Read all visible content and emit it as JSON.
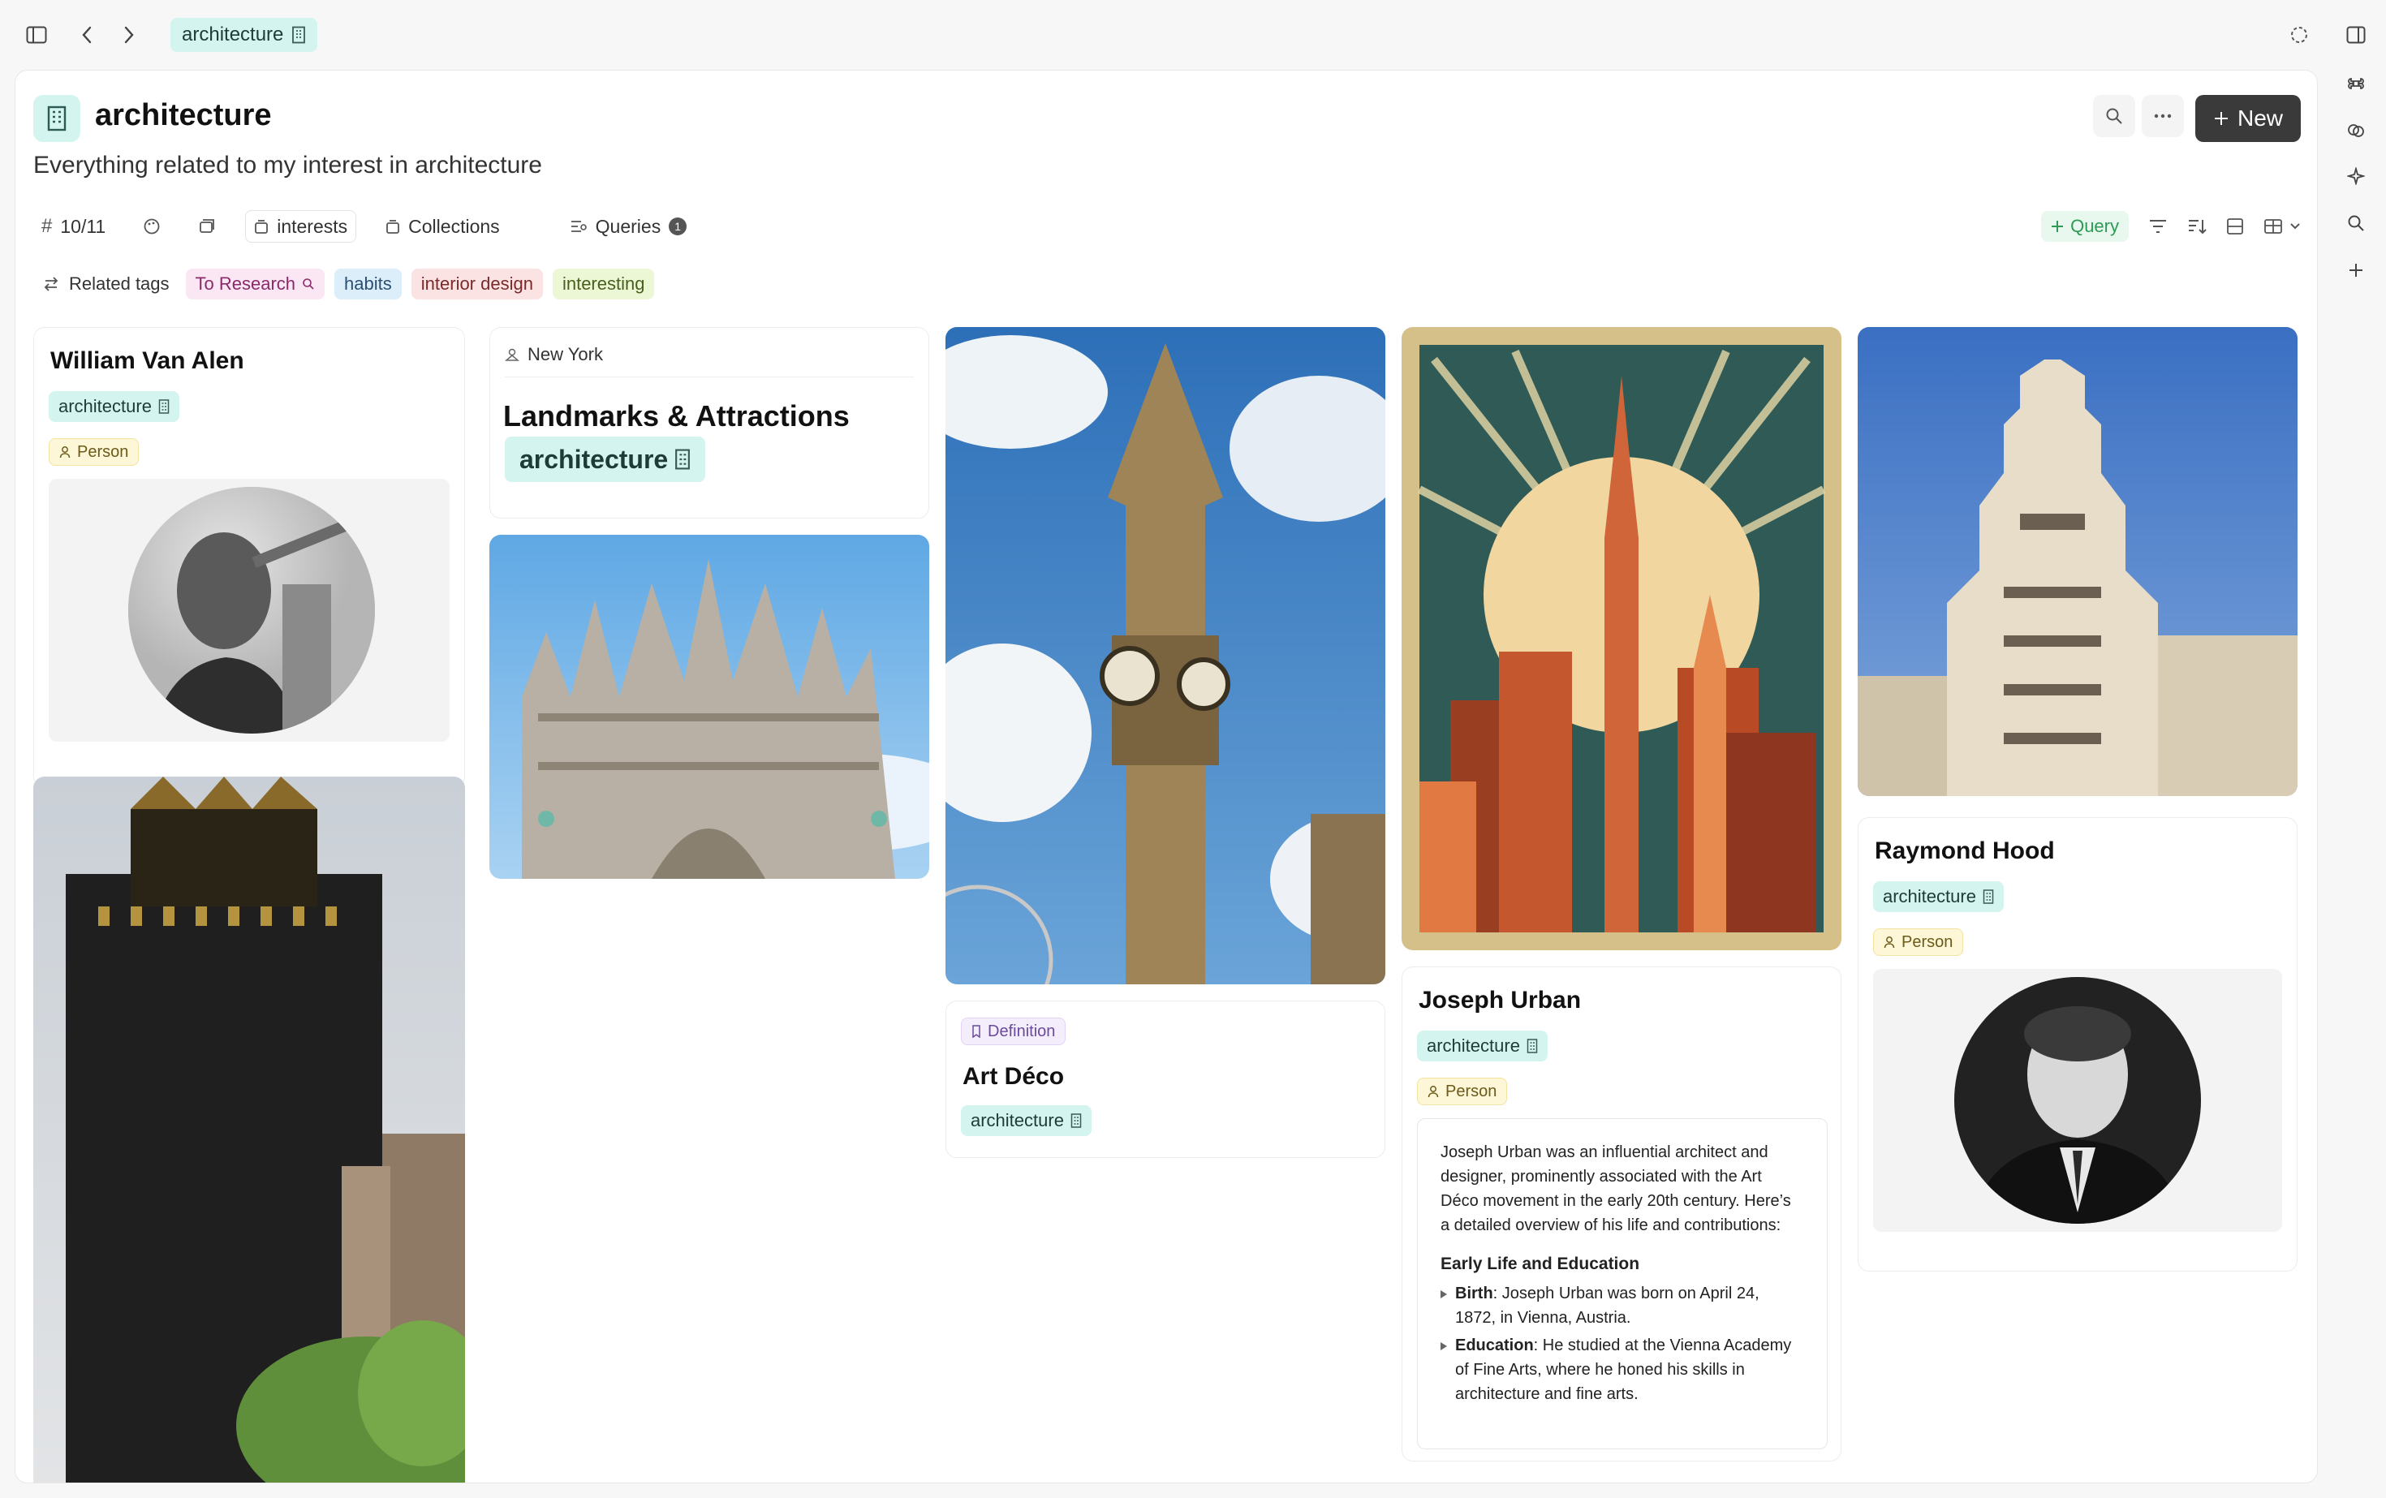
{
  "topbar": {
    "tab_label": "architecture"
  },
  "header": {
    "title": "architecture",
    "subtitle": "Everything related to my interest in architecture",
    "new_label": "New"
  },
  "toolbar": {
    "count": "10/11",
    "interests": "interests",
    "collections": "Collections",
    "queries": "Queries",
    "queries_count": "1",
    "query_button": "Query"
  },
  "related": {
    "label": "Related tags",
    "tags": [
      "To Research",
      "habits",
      "interior design",
      "interesting"
    ]
  },
  "cards": {
    "william": {
      "title": "William Van Alen",
      "tag": "architecture",
      "type": "Person"
    },
    "landmarks": {
      "location": "New York",
      "title": "Landmarks & Attractions",
      "tag": "architecture"
    },
    "artdeco": {
      "type": "Definition",
      "title": "Art Déco",
      "tag": "architecture"
    },
    "joseph": {
      "title": "Joseph Urban",
      "tag": "architecture",
      "type": "Person",
      "intro": "Joseph Urban was an influential architect and designer, prominently associated with the Art Déco movement in the early 20th century. Here’s a detailed overview of his life and contributions:",
      "section": "Early Life and Education",
      "b1_label": "Birth",
      "b1_text": ": Joseph Urban was born on April 24, 1872, in Vienna, Austria.",
      "b2_label": "Education",
      "b2_text": ": He studied at the Vienna Academy of Fine Arts, where he honed his skills in architecture and fine arts."
    },
    "raymond": {
      "title": "Raymond Hood",
      "tag": "architecture",
      "type": "Person"
    }
  },
  "colors": {
    "accent_teal": "#d4f4ef",
    "query_green": "#2e9a56",
    "new_button": "#3a3a3a"
  }
}
